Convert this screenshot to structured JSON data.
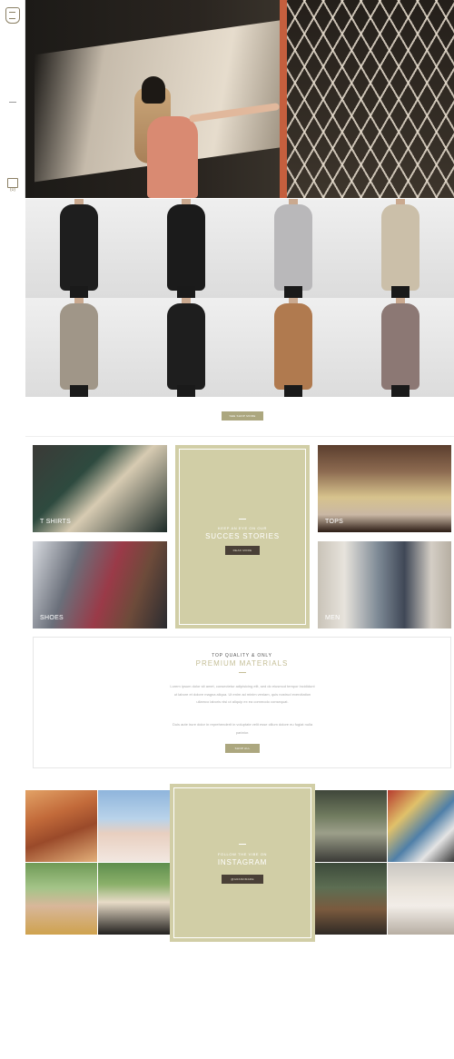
{
  "sidebar": {
    "cart_count": "(0)"
  },
  "hero": {
    "alt": "woman in lattice shadow"
  },
  "products": [
    {
      "dress_color": "#1e1e1e"
    },
    {
      "dress_color": "#1b1b1b"
    },
    {
      "dress_color": "#b9b8ba"
    },
    {
      "dress_color": "#cbbfa9"
    },
    {
      "dress_color": "#a09688"
    },
    {
      "dress_color": "#1e1e1e"
    },
    {
      "dress_color": "#b07a4f"
    },
    {
      "dress_color": "#8c7874"
    }
  ],
  "shop": {
    "more_label": "SEE SHOP MORE"
  },
  "categories": {
    "t_shirts": "T SHIRTS",
    "shoes": "SHOES",
    "tops": "TOPS",
    "men": "MEN"
  },
  "success": {
    "kicker": "KEEP AN EYE ON OUR",
    "title": "SUCCES STORIES",
    "button": "READ MORE"
  },
  "premium": {
    "kicker": "TOP QUALITY & ONLY",
    "title": "PREMIUM MATERIALS",
    "paragraph1": "Lorem ipsum dolor sit amet, consectetur adipisicing elit, sed do eiusmod tempor incididunt ut labore et dolore magna aliqua. Ut enim ad minim veniam, quis nostrud exercitation ullamco laboris nisi ut aliquip ex ea commodo consequat.",
    "paragraph2": "Duis aute irure dolor in reprehenderit in voluptate velit esse cillum dolore eu fugiat nulla pariatur.",
    "button": "SHOP ALL"
  },
  "instagram": {
    "kicker": "FOLLOW THE VIBE ON",
    "title": "INSTAGRAM",
    "button": "@GRANDMADE"
  },
  "colors": {
    "accent": "#aca77f",
    "panel": "#d1cea6",
    "dark_button": "#4a4037"
  }
}
